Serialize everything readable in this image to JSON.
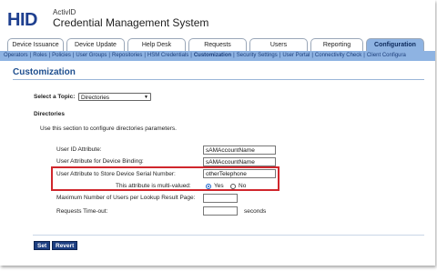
{
  "brand": {
    "logo": "HID",
    "product_line": "ActivID",
    "app_title": "Credential Management System"
  },
  "tabs": [
    {
      "label": "Device Issuance"
    },
    {
      "label": "Device Update"
    },
    {
      "label": "Help Desk"
    },
    {
      "label": "Requests"
    },
    {
      "label": "Users"
    },
    {
      "label": "Reporting"
    },
    {
      "label": "Configuration",
      "active": true
    }
  ],
  "subnav": {
    "items": [
      "Operators",
      "Roles",
      "Policies",
      "User Groups",
      "Repositories",
      "HSM Credentials",
      "Customization",
      "Security Settings",
      "User Portal",
      "Connectivity Check",
      "Client Configura"
    ],
    "current": "Customization"
  },
  "page": {
    "title": "Customization",
    "topic_label": "Select a Topic:",
    "topic_value": "Directories",
    "section_heading": "Directories",
    "section_desc": "Use this section to configure directories parameters."
  },
  "form": {
    "user_id_label": "User ID Attribute:",
    "user_id_value": "sAMAccountName",
    "binding_label": "User Attribute for Device Binding:",
    "binding_value": "sAMAccountName",
    "serial_label": "User Attribute to Store Device Serial Number:",
    "serial_value": "otherTelephone",
    "multivalued_label": "This attribute is multi-valued:",
    "yes_label": "Yes",
    "no_label": "No",
    "max_users_label": "Maximum Number of Users per Lookup Result Page:",
    "max_users_value": "",
    "timeout_label": "Requests Time-out:",
    "timeout_value": "",
    "timeout_unit": "seconds"
  },
  "buttons": {
    "set": "Set",
    "revert": "Revert"
  },
  "colors": {
    "accent": "#8eb3e2",
    "title": "#1f4f8f",
    "highlight": "#d0262c",
    "button": "#1d3f82"
  }
}
